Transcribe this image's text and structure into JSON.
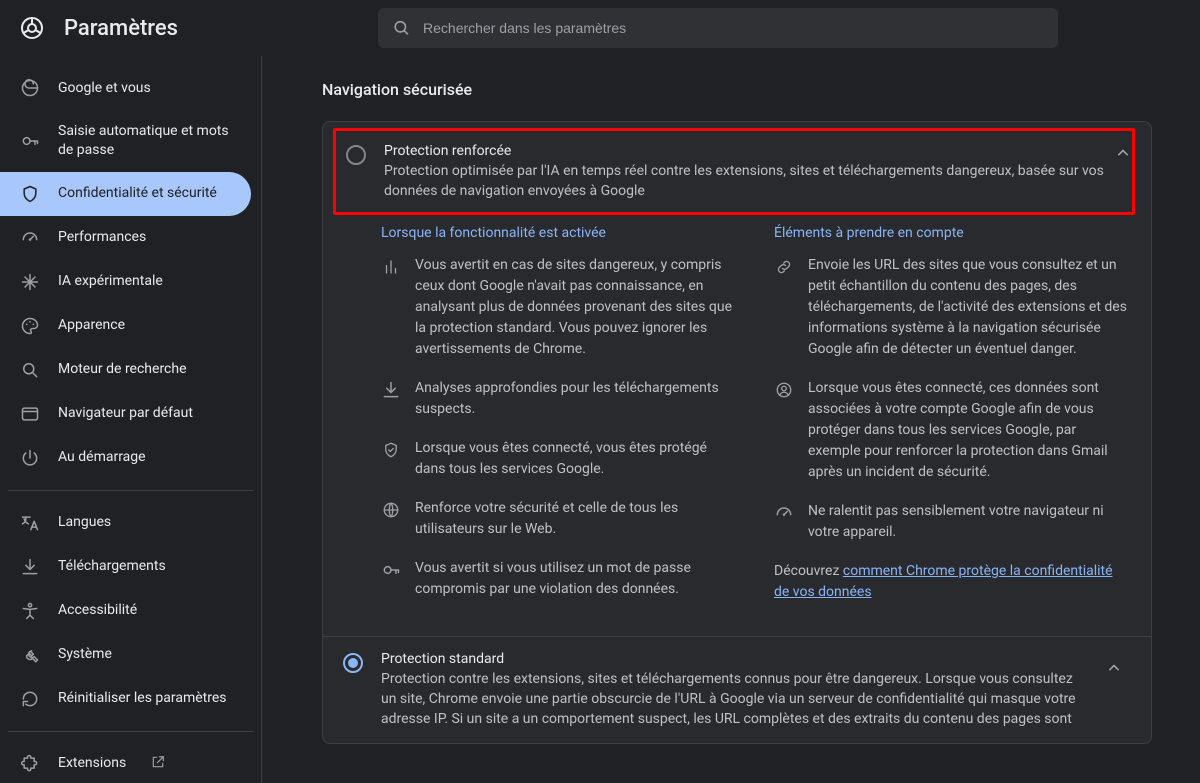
{
  "header": {
    "title": "Paramètres",
    "search_placeholder": "Rechercher dans les paramètres"
  },
  "sidebar": {
    "groups": [
      [
        {
          "icon": "google",
          "label": "Google et vous"
        },
        {
          "icon": "key",
          "label": "Saisie automatique et mots de passe"
        },
        {
          "icon": "shield",
          "label": "Confidentialité et sécurité",
          "selected": true
        },
        {
          "icon": "speed",
          "label": "Performances"
        },
        {
          "icon": "spark",
          "label": "IA expérimentale"
        },
        {
          "icon": "palette",
          "label": "Apparence"
        },
        {
          "icon": "search",
          "label": "Moteur de recherche"
        },
        {
          "icon": "browser",
          "label": "Navigateur par défaut"
        },
        {
          "icon": "power",
          "label": "Au démarrage"
        }
      ],
      [
        {
          "icon": "translate",
          "label": "Langues"
        },
        {
          "icon": "download",
          "label": "Téléchargements"
        },
        {
          "icon": "accessibility",
          "label": "Accessibilité"
        },
        {
          "icon": "wrench",
          "label": "Système"
        },
        {
          "icon": "reset",
          "label": "Réinitialiser les paramètres"
        }
      ],
      [
        {
          "icon": "extension",
          "label": "Extensions",
          "external": true
        }
      ]
    ]
  },
  "main": {
    "section_title": "Navigation sécurisée",
    "enhanced": {
      "title": "Protection renforcée",
      "desc": "Protection optimisée par l'IA en temps réel contre les extensions, sites et téléchargements dangereux, basée sur vos données de navigation envoyées à Google",
      "col1_header": "Lorsque la fonctionnalité est activée",
      "col2_header": "Éléments à prendre en compte",
      "col1": [
        {
          "icon": "chart",
          "text": "Vous avertit en cas de sites dangereux, y compris ceux dont Google n'avait pas connaissance, en analysant plus de données provenant des sites que la protection standard. Vous pouvez ignorer les avertissements de Chrome."
        },
        {
          "icon": "download",
          "text": "Analyses approfondies pour les téléchargements suspects."
        },
        {
          "icon": "shield-check",
          "text": "Lorsque vous êtes connecté, vous êtes protégé dans tous les services Google."
        },
        {
          "icon": "globe",
          "text": "Renforce votre sécurité et celle de tous les utilisateurs sur le Web."
        },
        {
          "icon": "key",
          "text": "Vous avertit si vous utilisez un mot de passe compromis par une violation des données."
        }
      ],
      "col2": [
        {
          "icon": "link",
          "text": "Envoie les URL des sites que vous consultez et un petit échantillon du contenu des pages, des téléchargements, de l'activité des extensions et des informations système à la navigation sécurisée Google afin de détecter un éventuel danger."
        },
        {
          "icon": "account",
          "text": "Lorsque vous êtes connecté, ces données sont associées à votre compte Google afin de vous protéger dans tous les services Google, par exemple pour renforcer la protection dans Gmail après un incident de sécurité."
        },
        {
          "icon": "speed",
          "text": "Ne ralentit pas sensiblement votre navigateur ni votre appareil."
        }
      ],
      "learn_prefix": "Découvrez ",
      "learn_link": "comment Chrome protège la confidentialité de vos données"
    },
    "standard": {
      "title": "Protection standard",
      "desc": "Protection contre les extensions, sites et téléchargements connus pour être dangereux. Lorsque vous consultez un site, Chrome envoie une partie obscurcie de l'URL à Google via un serveur de confidentialité qui masque votre adresse IP. Si un site a un comportement suspect, les URL complètes et des extraits du contenu des pages sont"
    }
  }
}
